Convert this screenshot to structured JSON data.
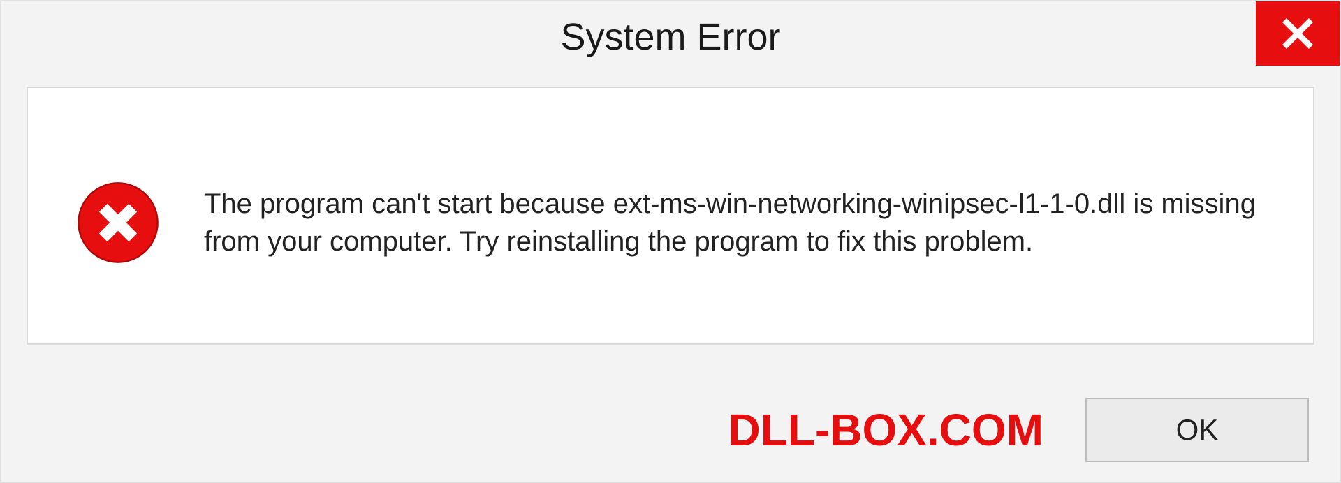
{
  "titlebar": {
    "title": "System Error",
    "close_icon": "close-icon"
  },
  "body": {
    "error_icon": "error-circle-x-icon",
    "message": "The program can't start because ext-ms-win-networking-winipsec-l1-1-0.dll is missing from your computer. Try reinstalling the program to fix this problem."
  },
  "footer": {
    "watermark": "DLL-BOX.COM",
    "ok_label": "OK"
  },
  "colors": {
    "accent_red": "#e60e0e",
    "background": "#f3f3f3",
    "panel": "#ffffff",
    "border": "#d9d9d9",
    "button_bg": "#ebebeb",
    "button_border": "#bcbcbc",
    "text": "#222222"
  }
}
